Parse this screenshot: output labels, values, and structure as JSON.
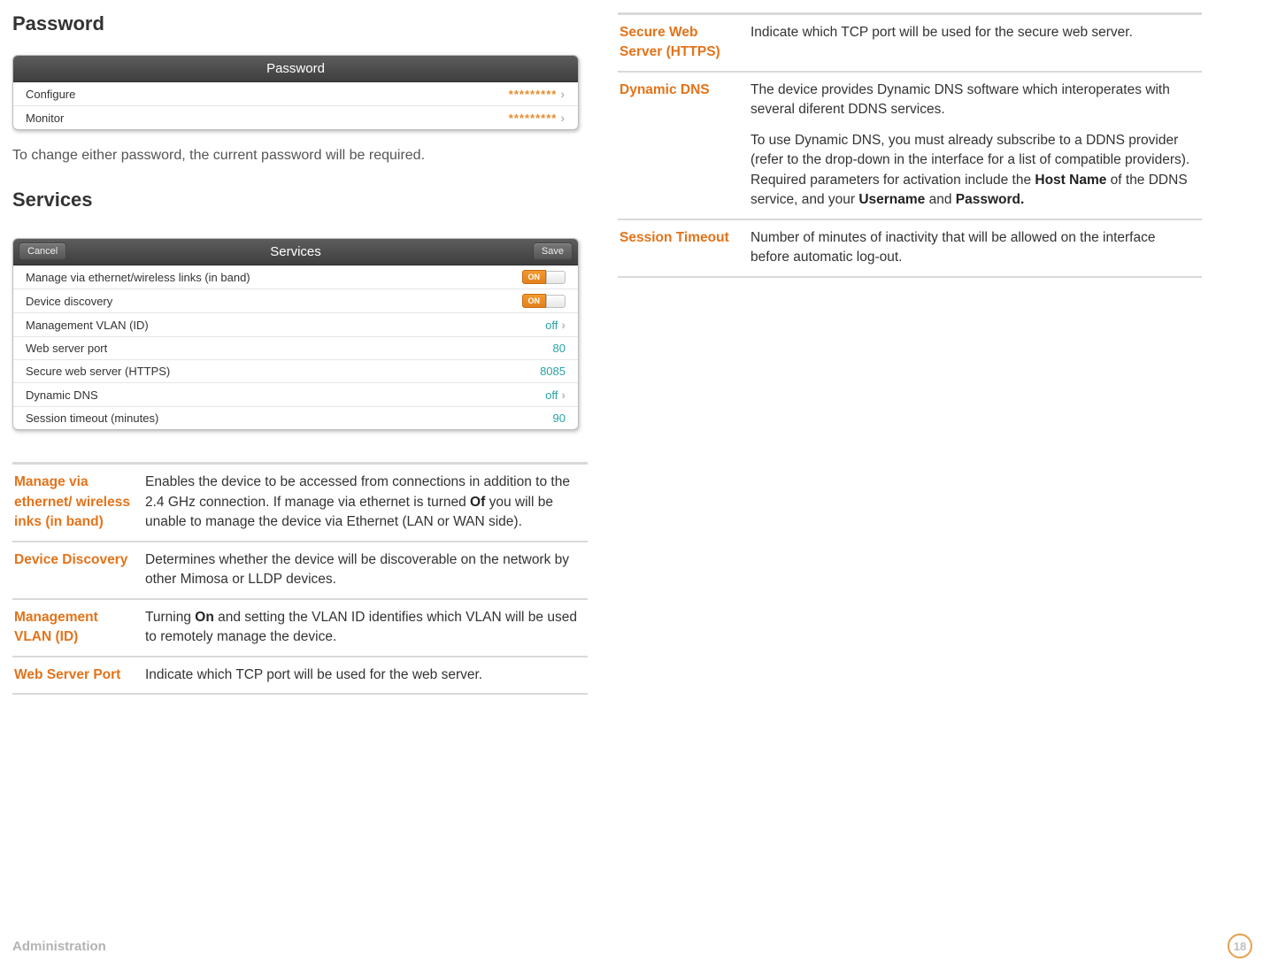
{
  "left": {
    "password_heading": "Password",
    "password_panel": {
      "title": "Password",
      "rows": [
        {
          "label": "Configure",
          "value": "*********"
        },
        {
          "label": "Monitor",
          "value": "*********"
        }
      ]
    },
    "password_note": "To change either password, the current password will be required.",
    "services_heading": "Services",
    "services_panel": {
      "title": "Services",
      "cancel": "Cancel",
      "save": "Save",
      "rows": [
        {
          "label": "Manage via ethernet/wireless links (in band)",
          "type": "toggle",
          "value": "ON"
        },
        {
          "label": "Device discovery",
          "type": "toggle",
          "value": "ON"
        },
        {
          "label": "Management VLAN (ID)",
          "type": "link",
          "value": "off"
        },
        {
          "label": "Web server port",
          "type": "value",
          "value": "80"
        },
        {
          "label": "Secure web server (HTTPS)",
          "type": "value",
          "value": "8085"
        },
        {
          "label": "Dynamic DNS",
          "type": "link",
          "value": "off"
        },
        {
          "label": "Session timeout (minutes)",
          "type": "value",
          "value": "90"
        }
      ]
    },
    "defs": [
      {
        "term": "Manage via ethernet/ wireless inks (in band)",
        "desc": "Enables the device to be accessed from connections in addition to the 2.4 GHz connection. If manage via ethernet is turned <b>Of</b> you will be unable to manage the device via Ethernet (LAN or WAN side)."
      },
      {
        "term": "Device Discovery",
        "desc": "Determines whether the device will be discoverable on the network by other Mimosa or LLDP devices."
      },
      {
        "term": "Management VLAN (ID)",
        "desc": "Turning <b>On</b> and setting the VLAN ID identifies which VLAN will be used to remotely manage the device."
      },
      {
        "term": "Web Server Port",
        "desc": "Indicate which TCP port will be used for the web server."
      }
    ]
  },
  "right": {
    "defs": [
      {
        "term": "Secure Web Server (HTTPS)",
        "desc": "Indicate which TCP port will be used for the secure web server."
      },
      {
        "term": "Dynamic DNS",
        "desc": "<p>The device provides Dynamic DNS software which interoperates with several diferent DDNS services.</p><p>To use Dynamic DNS, you must already subscribe to a DDNS provider (refer to the drop-down in the interface for a list of compatible providers). Required parameters for activation include the <b>Host Name</b> of the DDNS service, and your <b>Username</b> and <b>Password.</b></p>"
      },
      {
        "term": "Session Timeout",
        "desc": "Number of minutes of inactivity that will be allowed on the interface before automatic log-out."
      }
    ]
  },
  "footer": {
    "label": "Administration",
    "page": "18"
  }
}
